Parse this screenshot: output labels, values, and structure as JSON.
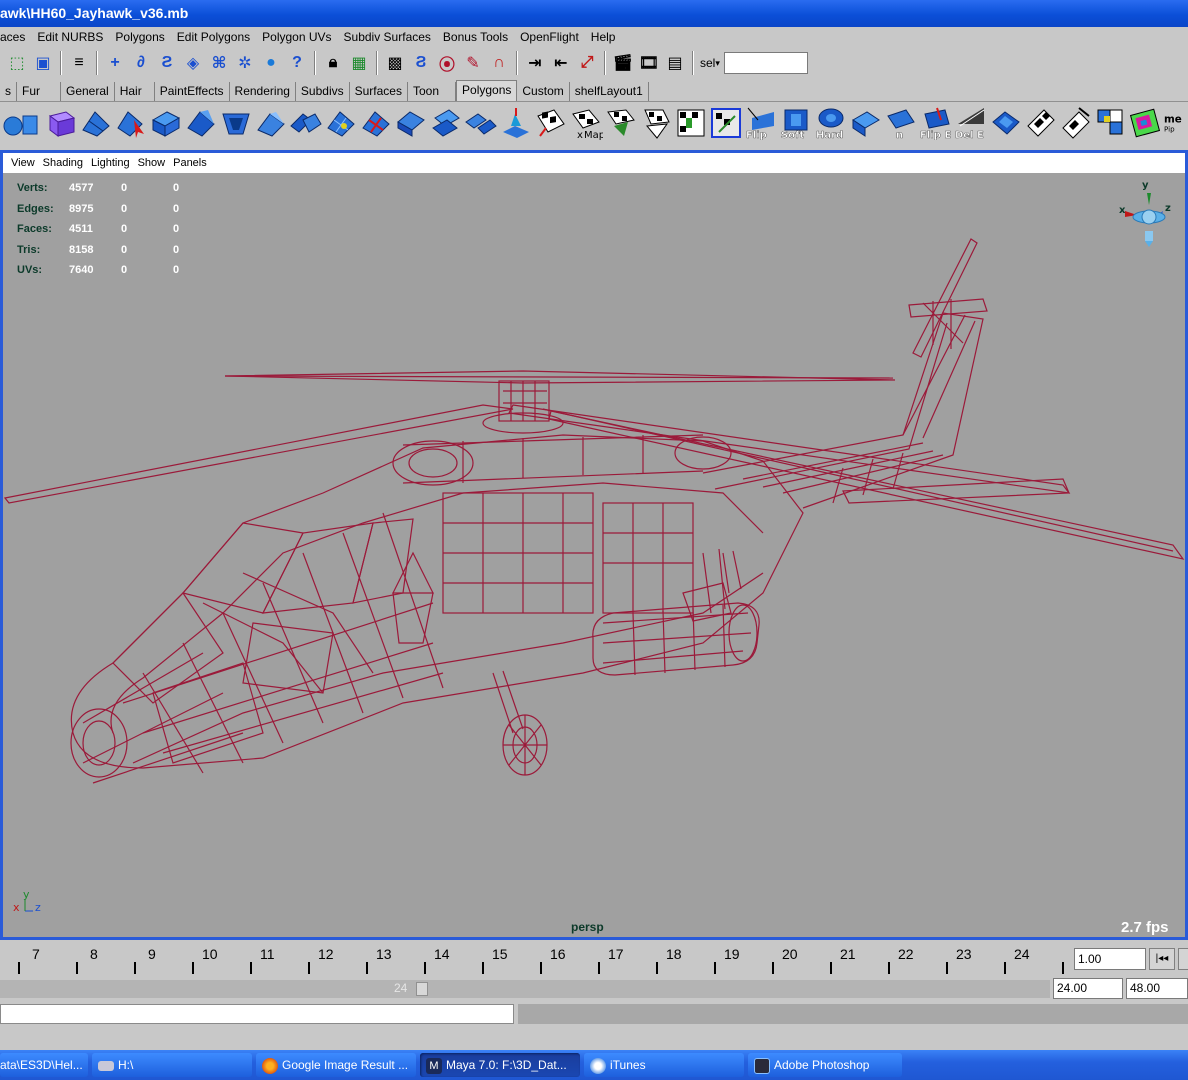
{
  "window": {
    "title": "awk\\HH60_Jayhawk_v36.mb"
  },
  "menu": [
    "aces",
    "Edit NURBS",
    "Polygons",
    "Edit Polygons",
    "Polygon UVs",
    "Subdiv Surfaces",
    "Bonus Tools",
    "OpenFlight",
    "Help"
  ],
  "statusline": {
    "icons": [
      "select-by-hierarchy-icon",
      "select-by-object-icon",
      "select-by-component-icon",
      "snap-menu-icon",
      "snap-grid-icon",
      "snap-curve-icon",
      "snap-point-icon",
      "snap-view-plane-icon",
      "snap-live-icon",
      "history-icon",
      "help-icon",
      "lock-icon",
      "selection-mask-icon",
      "construction-history-icon",
      "input-ops-icon",
      "render-icon",
      "magnet-icon",
      "input-line-icon",
      "output-line-icon",
      "ipr-icon",
      "render-clapper-icon",
      "ipr-render-icon",
      "render-globals-icon"
    ],
    "sel_label": "sel",
    "sel_value": ""
  },
  "shelf_tabs": [
    "s",
    "Fur",
    "General",
    "Hair",
    "PaintEffects",
    "Rendering",
    "Subdivs",
    "Surfaces",
    "Toon",
    "Polygons",
    "Custom",
    "shelfLayout1"
  ],
  "active_shelf": "Polygons",
  "shelf_icon_labels": [
    "Map",
    "Flip",
    "Soft",
    "Hard",
    "Flip E",
    "Del E",
    "me",
    "Pip"
  ],
  "viewport": {
    "menu": [
      "View",
      "Shading",
      "Lighting",
      "Show",
      "Panels"
    ],
    "hud": [
      {
        "label": "Verts:",
        "values": [
          "4577",
          "0",
          "0"
        ]
      },
      {
        "label": "Edges:",
        "values": [
          "8975",
          "0",
          "0"
        ]
      },
      {
        "label": "Faces:",
        "values": [
          "4511",
          "0",
          "0"
        ]
      },
      {
        "label": "Tris:",
        "values": [
          "8158",
          "0",
          "0"
        ]
      },
      {
        "label": "UVs:",
        "values": [
          "7640",
          "0",
          "0"
        ]
      }
    ],
    "camera": "persp",
    "fps": "2.7 fps",
    "wire_color": "#9b1a3a",
    "gizmo_labels": {
      "y": "y",
      "x": "x",
      "z": "z"
    }
  },
  "timeline": {
    "ticks": [
      "7",
      "8",
      "9",
      "10",
      "11",
      "12",
      "13",
      "14",
      "15",
      "16",
      "17",
      "18",
      "19",
      "20",
      "21",
      "22",
      "23",
      "24"
    ],
    "current_frame": "1.00",
    "prev_label": "|◂◂"
  },
  "range": {
    "handle_label": "24",
    "end_time": "24.00",
    "max_time": "48.00"
  },
  "taskbar": [
    {
      "label": "ata\\ES3D\\Hel...",
      "icon": "folder-icon",
      "active": false
    },
    {
      "label": "H:\\",
      "icon": "drive-icon",
      "active": false
    },
    {
      "label": "Google Image Result ...",
      "icon": "firefox-icon",
      "active": false
    },
    {
      "label": "Maya 7.0: F:\\3D_Dat...",
      "icon": "maya-icon",
      "active": true
    },
    {
      "label": "iTunes",
      "icon": "itunes-icon",
      "active": false
    },
    {
      "label": "Adobe Photoshop",
      "icon": "photoshop-icon",
      "active": false
    }
  ]
}
